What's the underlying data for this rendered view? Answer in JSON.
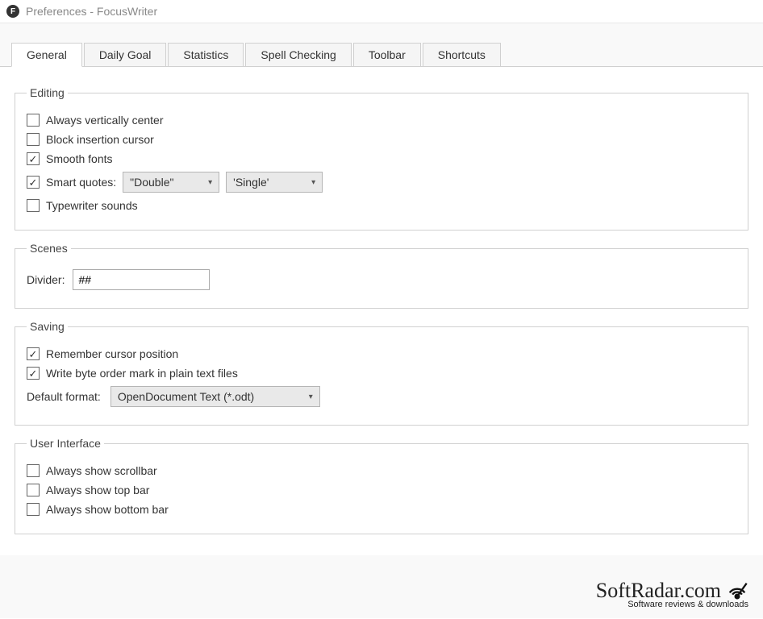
{
  "window": {
    "title": "Preferences - FocusWriter",
    "app_icon_letter": "F"
  },
  "tabs": [
    {
      "label": "General",
      "active": true
    },
    {
      "label": "Daily Goal",
      "active": false
    },
    {
      "label": "Statistics",
      "active": false
    },
    {
      "label": "Spell Checking",
      "active": false
    },
    {
      "label": "Toolbar",
      "active": false
    },
    {
      "label": "Shortcuts",
      "active": false
    }
  ],
  "editing": {
    "legend": "Editing",
    "always_center": {
      "label": "Always vertically center",
      "checked": false
    },
    "block_cursor": {
      "label": "Block insertion cursor",
      "checked": false
    },
    "smooth_fonts": {
      "label": "Smooth fonts",
      "checked": true
    },
    "smart_quotes": {
      "label": "Smart quotes:",
      "checked": true,
      "double_value": "\"Double\"",
      "single_value": "'Single'"
    },
    "typewriter": {
      "label": "Typewriter sounds",
      "checked": false
    }
  },
  "scenes": {
    "legend": "Scenes",
    "divider_label": "Divider:",
    "divider_value": "##"
  },
  "saving": {
    "legend": "Saving",
    "remember_cursor": {
      "label": "Remember cursor position",
      "checked": true
    },
    "write_bom": {
      "label": "Write byte order mark in plain text files",
      "checked": true
    },
    "default_format_label": "Default format:",
    "default_format_value": "OpenDocument Text (*.odt)"
  },
  "ui": {
    "legend": "User Interface",
    "show_scrollbar": {
      "label": "Always show scrollbar",
      "checked": false
    },
    "show_top": {
      "label": "Always show top bar",
      "checked": false
    },
    "show_bottom": {
      "label": "Always show bottom bar",
      "checked": false
    }
  },
  "watermark": {
    "main": "SoftRadar.com",
    "sub": "Software reviews & downloads"
  }
}
